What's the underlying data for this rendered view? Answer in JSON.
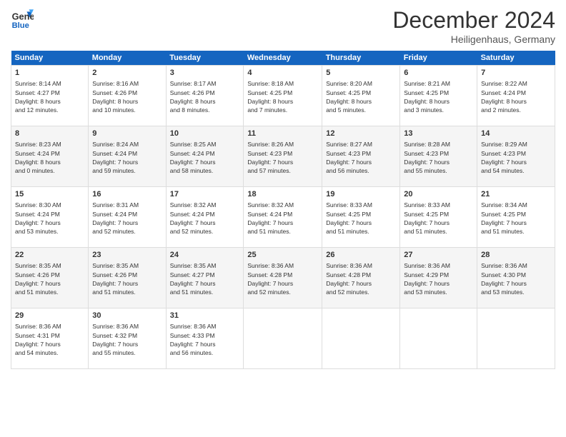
{
  "header": {
    "logo_line1": "General",
    "logo_line2": "Blue",
    "month": "December 2024",
    "location": "Heiligenhaus, Germany"
  },
  "weekdays": [
    "Sunday",
    "Monday",
    "Tuesday",
    "Wednesday",
    "Thursday",
    "Friday",
    "Saturday"
  ],
  "weeks": [
    [
      {
        "day": "1",
        "info": "Sunrise: 8:14 AM\nSunset: 4:27 PM\nDaylight: 8 hours\nand 12 minutes."
      },
      {
        "day": "2",
        "info": "Sunrise: 8:16 AM\nSunset: 4:26 PM\nDaylight: 8 hours\nand 10 minutes."
      },
      {
        "day": "3",
        "info": "Sunrise: 8:17 AM\nSunset: 4:26 PM\nDaylight: 8 hours\nand 8 minutes."
      },
      {
        "day": "4",
        "info": "Sunrise: 8:18 AM\nSunset: 4:25 PM\nDaylight: 8 hours\nand 7 minutes."
      },
      {
        "day": "5",
        "info": "Sunrise: 8:20 AM\nSunset: 4:25 PM\nDaylight: 8 hours\nand 5 minutes."
      },
      {
        "day": "6",
        "info": "Sunrise: 8:21 AM\nSunset: 4:25 PM\nDaylight: 8 hours\nand 3 minutes."
      },
      {
        "day": "7",
        "info": "Sunrise: 8:22 AM\nSunset: 4:24 PM\nDaylight: 8 hours\nand 2 minutes."
      }
    ],
    [
      {
        "day": "8",
        "info": "Sunrise: 8:23 AM\nSunset: 4:24 PM\nDaylight: 8 hours\nand 0 minutes."
      },
      {
        "day": "9",
        "info": "Sunrise: 8:24 AM\nSunset: 4:24 PM\nDaylight: 7 hours\nand 59 minutes."
      },
      {
        "day": "10",
        "info": "Sunrise: 8:25 AM\nSunset: 4:24 PM\nDaylight: 7 hours\nand 58 minutes."
      },
      {
        "day": "11",
        "info": "Sunrise: 8:26 AM\nSunset: 4:23 PM\nDaylight: 7 hours\nand 57 minutes."
      },
      {
        "day": "12",
        "info": "Sunrise: 8:27 AM\nSunset: 4:23 PM\nDaylight: 7 hours\nand 56 minutes."
      },
      {
        "day": "13",
        "info": "Sunrise: 8:28 AM\nSunset: 4:23 PM\nDaylight: 7 hours\nand 55 minutes."
      },
      {
        "day": "14",
        "info": "Sunrise: 8:29 AM\nSunset: 4:23 PM\nDaylight: 7 hours\nand 54 minutes."
      }
    ],
    [
      {
        "day": "15",
        "info": "Sunrise: 8:30 AM\nSunset: 4:24 PM\nDaylight: 7 hours\nand 53 minutes."
      },
      {
        "day": "16",
        "info": "Sunrise: 8:31 AM\nSunset: 4:24 PM\nDaylight: 7 hours\nand 52 minutes."
      },
      {
        "day": "17",
        "info": "Sunrise: 8:32 AM\nSunset: 4:24 PM\nDaylight: 7 hours\nand 52 minutes."
      },
      {
        "day": "18",
        "info": "Sunrise: 8:32 AM\nSunset: 4:24 PM\nDaylight: 7 hours\nand 51 minutes."
      },
      {
        "day": "19",
        "info": "Sunrise: 8:33 AM\nSunset: 4:25 PM\nDaylight: 7 hours\nand 51 minutes."
      },
      {
        "day": "20",
        "info": "Sunrise: 8:33 AM\nSunset: 4:25 PM\nDaylight: 7 hours\nand 51 minutes."
      },
      {
        "day": "21",
        "info": "Sunrise: 8:34 AM\nSunset: 4:25 PM\nDaylight: 7 hours\nand 51 minutes."
      }
    ],
    [
      {
        "day": "22",
        "info": "Sunrise: 8:35 AM\nSunset: 4:26 PM\nDaylight: 7 hours\nand 51 minutes."
      },
      {
        "day": "23",
        "info": "Sunrise: 8:35 AM\nSunset: 4:26 PM\nDaylight: 7 hours\nand 51 minutes."
      },
      {
        "day": "24",
        "info": "Sunrise: 8:35 AM\nSunset: 4:27 PM\nDaylight: 7 hours\nand 51 minutes."
      },
      {
        "day": "25",
        "info": "Sunrise: 8:36 AM\nSunset: 4:28 PM\nDaylight: 7 hours\nand 52 minutes."
      },
      {
        "day": "26",
        "info": "Sunrise: 8:36 AM\nSunset: 4:28 PM\nDaylight: 7 hours\nand 52 minutes."
      },
      {
        "day": "27",
        "info": "Sunrise: 8:36 AM\nSunset: 4:29 PM\nDaylight: 7 hours\nand 53 minutes."
      },
      {
        "day": "28",
        "info": "Sunrise: 8:36 AM\nSunset: 4:30 PM\nDaylight: 7 hours\nand 53 minutes."
      }
    ],
    [
      {
        "day": "29",
        "info": "Sunrise: 8:36 AM\nSunset: 4:31 PM\nDaylight: 7 hours\nand 54 minutes."
      },
      {
        "day": "30",
        "info": "Sunrise: 8:36 AM\nSunset: 4:32 PM\nDaylight: 7 hours\nand 55 minutes."
      },
      {
        "day": "31",
        "info": "Sunrise: 8:36 AM\nSunset: 4:33 PM\nDaylight: 7 hours\nand 56 minutes."
      },
      null,
      null,
      null,
      null
    ]
  ]
}
